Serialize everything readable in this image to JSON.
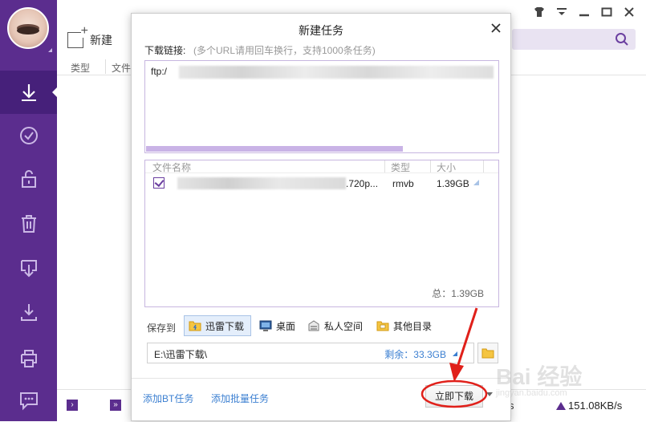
{
  "window": {
    "minimize_icon": "minimize-icon",
    "maximize_icon": "maximize-icon",
    "close_icon": "close-icon",
    "skin_icon": "shirt-icon",
    "menu_icon": "menu-icon"
  },
  "sidebar": {
    "accent": "#5b2d8e",
    "items": [
      {
        "name": "download",
        "icon": "download-arrow-icon"
      },
      {
        "name": "completed",
        "icon": "check-circle-icon"
      },
      {
        "name": "private",
        "icon": "unlock-icon"
      },
      {
        "name": "trash",
        "icon": "trash-icon"
      },
      {
        "name": "downloaded",
        "icon": "download-box-icon"
      },
      {
        "name": "install",
        "icon": "download-tray-icon"
      },
      {
        "name": "print",
        "icon": "printer-icon"
      },
      {
        "name": "chat",
        "icon": "chat-icon"
      }
    ]
  },
  "toolbar": {
    "new_label": "新建"
  },
  "main": {
    "columns": [
      "类型",
      "文件"
    ]
  },
  "status": {
    "speed": "151.08KB/s",
    "tail_char": "s"
  },
  "dialog": {
    "title": "新建任务",
    "url_label": "下载链接:",
    "url_hint": "(多个URL请用回车换行，支持1000条任务)",
    "url_prefix": "ftp:/",
    "file_list": {
      "headers": {
        "name": "文件名称",
        "type": "类型",
        "size": "大小"
      },
      "rows": [
        {
          "checked": true,
          "name_suffix": ".720p...",
          "type": "rmvb",
          "size": "1.39GB"
        }
      ],
      "total": "总：1.39GB"
    },
    "save_to_label": "保存到",
    "locations": [
      {
        "label": "迅雷下载",
        "icon": "folder-thunder-icon",
        "selected": true
      },
      {
        "label": "桌面",
        "icon": "desktop-icon",
        "selected": false
      },
      {
        "label": "私人空间",
        "icon": "private-space-icon",
        "selected": false
      },
      {
        "label": "其他目录",
        "icon": "folder-icon",
        "selected": false
      }
    ],
    "path": "E:\\迅雷下载\\",
    "free_space": "剩余：33.3GB",
    "links": {
      "bt": "添加BT任务",
      "batch": "添加批量任务"
    },
    "download_button": "立即下载"
  },
  "watermark": {
    "text": "Bai 经验",
    "sub": "jingyan.baidu.com"
  }
}
